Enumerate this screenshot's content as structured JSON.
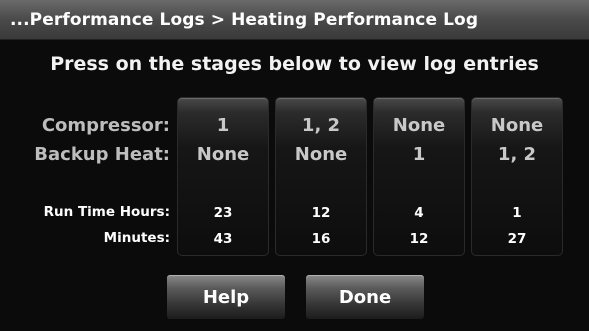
{
  "header": {
    "breadcrumb": "...Performance Logs > Heating Performance Log"
  },
  "instruction": "Press on the stages below to view log entries",
  "labels": {
    "compressor": "Compressor:",
    "backup_heat": "Backup Heat:",
    "run_time_hours": "Run Time Hours:",
    "minutes": "Minutes:"
  },
  "stages": [
    {
      "compressor": "1",
      "backup_heat": "None",
      "hours": "23",
      "minutes": "43"
    },
    {
      "compressor": "1, 2",
      "backup_heat": "None",
      "hours": "12",
      "minutes": "16"
    },
    {
      "compressor": "None",
      "backup_heat": "1",
      "hours": "4",
      "minutes": "12"
    },
    {
      "compressor": "None",
      "backup_heat": "1, 2",
      "hours": "1",
      "minutes": "27"
    }
  ],
  "buttons": {
    "help": "Help",
    "done": "Done"
  }
}
